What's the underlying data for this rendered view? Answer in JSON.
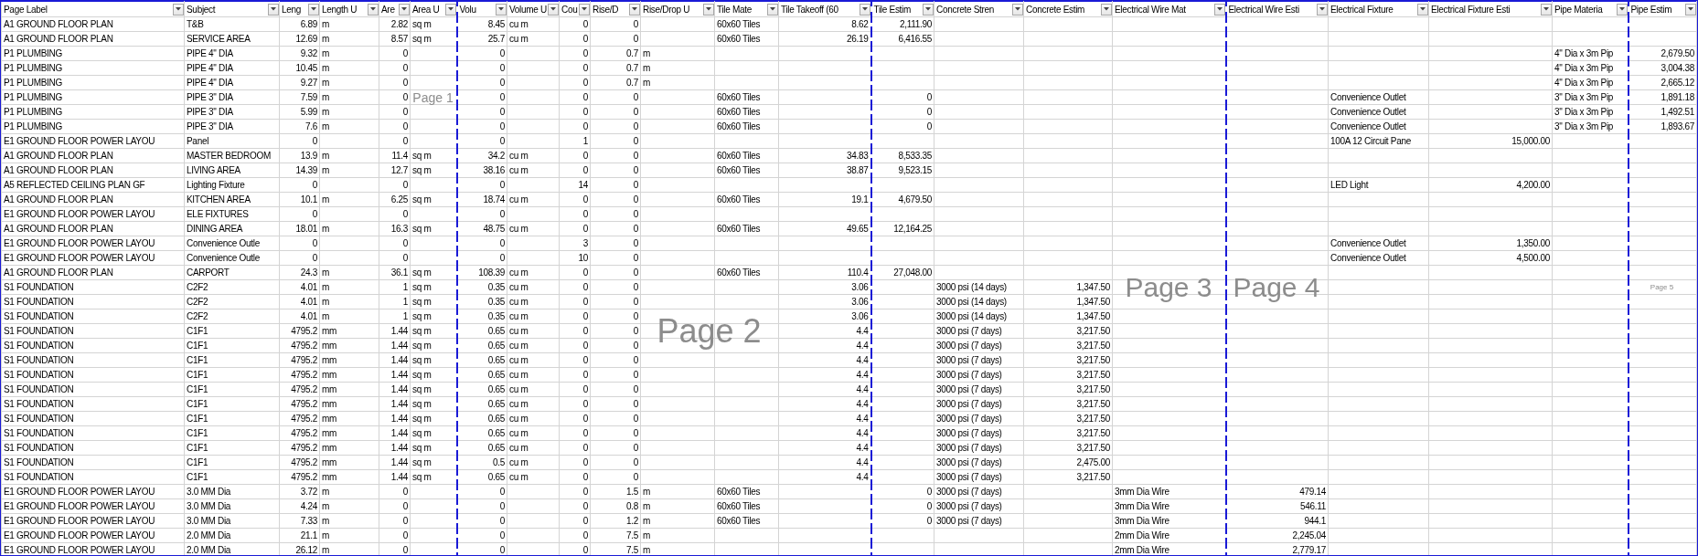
{
  "columns": [
    {
      "label": "Page Label",
      "kind": "text",
      "page_break_after": false
    },
    {
      "label": "Subject",
      "kind": "text",
      "page_break_after": false
    },
    {
      "label": "Leng",
      "kind": "number",
      "page_break_after": false
    },
    {
      "label": "Length U",
      "kind": "text",
      "page_break_after": false
    },
    {
      "label": "Are",
      "kind": "number",
      "page_break_after": false
    },
    {
      "label": "Area U",
      "kind": "text",
      "page_break_after": true
    },
    {
      "label": "Volu",
      "kind": "number",
      "page_break_after": false
    },
    {
      "label": "Volume U",
      "kind": "text",
      "page_break_after": false
    },
    {
      "label": "Cou",
      "kind": "number",
      "page_break_after": false
    },
    {
      "label": "Rise/D",
      "kind": "number",
      "page_break_after": false
    },
    {
      "label": "Rise/Drop U",
      "kind": "text",
      "page_break_after": false
    },
    {
      "label": "Tile Mate",
      "kind": "text",
      "page_break_after": false
    },
    {
      "label": "Tile Takeoff (60",
      "kind": "number",
      "page_break_after": true
    },
    {
      "label": "Tile Estim",
      "kind": "number",
      "page_break_after": false
    },
    {
      "label": "Concrete Stren",
      "kind": "text",
      "page_break_after": false
    },
    {
      "label": "Concrete Estim",
      "kind": "number",
      "page_break_after": false
    },
    {
      "label": "Electrical Wire Mat",
      "kind": "text",
      "page_break_after": true
    },
    {
      "label": "Electrical Wire Esti",
      "kind": "number",
      "page_break_after": false
    },
    {
      "label": "Electrical Fixture",
      "kind": "text",
      "page_break_after": false
    },
    {
      "label": "Electrical Fixture Esti",
      "kind": "number",
      "page_break_after": false
    },
    {
      "label": "Pipe Materia",
      "kind": "text",
      "page_break_after": true
    },
    {
      "label": "Pipe Estim",
      "kind": "number",
      "page_break_after": false
    }
  ],
  "pages": [
    {
      "label": "Page 1"
    },
    {
      "label": "Page 2"
    },
    {
      "label": "Page 3"
    },
    {
      "label": "Page 4"
    },
    {
      "label": "Page 5"
    }
  ],
  "rows": [
    [
      "A1 GROUND FLOOR PLAN",
      "T&B",
      "6.89",
      "m",
      "2.82",
      "sq m",
      "8.45",
      "cu m",
      "0",
      "0",
      null,
      "60x60 Tiles",
      "8.62",
      "2,111.90",
      null,
      null,
      null,
      null,
      null,
      null,
      null,
      null
    ],
    [
      "A1 GROUND FLOOR PLAN",
      "SERVICE AREA",
      "12.69",
      "m",
      "8.57",
      "sq m",
      "25.7",
      "cu m",
      "0",
      "0",
      null,
      "60x60 Tiles",
      "26.19",
      "6,416.55",
      null,
      null,
      null,
      null,
      null,
      null,
      null,
      null
    ],
    [
      "P1 PLUMBING",
      "PIPE 4\" DIA",
      "9.32",
      "m",
      "0",
      null,
      "0",
      null,
      "0",
      "0.7",
      "m",
      null,
      null,
      null,
      null,
      null,
      null,
      null,
      null,
      null,
      "4\" Dia x 3m Pip",
      "2,679.50"
    ],
    [
      "P1 PLUMBING",
      "PIPE 4\" DIA",
      "10.45",
      "m",
      "0",
      null,
      "0",
      null,
      "0",
      "0.7",
      "m",
      null,
      null,
      null,
      null,
      null,
      null,
      null,
      null,
      null,
      "4\" Dia x 3m Pip",
      "3,004.38"
    ],
    [
      "P1 PLUMBING",
      "PIPE 4\" DIA",
      "9.27",
      "m",
      "0",
      null,
      "0",
      null,
      "0",
      "0.7",
      "m",
      null,
      null,
      null,
      null,
      null,
      null,
      null,
      null,
      null,
      "4\" Dia x 3m Pip",
      "2,665.12"
    ],
    [
      "P1 PLUMBING",
      "PIPE 3\" DIA",
      "7.59",
      "m",
      "0",
      null,
      "0",
      null,
      "0",
      "0",
      null,
      "60x60 Tiles",
      null,
      "0",
      null,
      null,
      null,
      null,
      "Convenience Outlet",
      null,
      "3\" Dia x 3m Pip",
      "1,891.18"
    ],
    [
      "P1 PLUMBING",
      "PIPE 3\" DIA",
      "5.99",
      "m",
      "0",
      null,
      "0",
      null,
      "0",
      "0",
      null,
      "60x60 Tiles",
      null,
      "0",
      null,
      null,
      null,
      null,
      "Convenience Outlet",
      null,
      "3\" Dia x 3m Pip",
      "1,492.51"
    ],
    [
      "P1 PLUMBING",
      "PIPE 3\" DIA",
      "7.6",
      "m",
      "0",
      null,
      "0",
      null,
      "0",
      "0",
      null,
      "60x60 Tiles",
      null,
      "0",
      null,
      null,
      null,
      null,
      "Convenience Outlet",
      null,
      "3\" Dia x 3m Pip",
      "1,893.67"
    ],
    [
      "E1 GROUND FLOOR POWER LAYOU",
      "Panel",
      "0",
      null,
      "0",
      null,
      "0",
      null,
      "1",
      "0",
      null,
      null,
      null,
      null,
      null,
      null,
      null,
      null,
      "100A 12 Circuit Pane",
      "15,000.00",
      null,
      null
    ],
    [
      "A1 GROUND FLOOR PLAN",
      "MASTER BEDROOM",
      "13.9",
      "m",
      "11.4",
      "sq m",
      "34.2",
      "cu m",
      "0",
      "0",
      null,
      "60x60 Tiles",
      "34.83",
      "8,533.35",
      null,
      null,
      null,
      null,
      null,
      null,
      null,
      null
    ],
    [
      "A1 GROUND FLOOR PLAN",
      "LIVING AREA",
      "14.39",
      "m",
      "12.7",
      "sq m",
      "38.16",
      "cu m",
      "0",
      "0",
      null,
      "60x60 Tiles",
      "38.87",
      "9,523.15",
      null,
      null,
      null,
      null,
      null,
      null,
      null,
      null
    ],
    [
      "A5 REFLECTED CEILING PLAN GF",
      "Lighting Fixture",
      "0",
      null,
      "0",
      null,
      "0",
      null,
      "14",
      "0",
      null,
      null,
      null,
      null,
      null,
      null,
      null,
      null,
      "LED Light",
      "4,200.00",
      null,
      null
    ],
    [
      "A1 GROUND FLOOR PLAN",
      "KITCHEN AREA",
      "10.1",
      "m",
      "6.25",
      "sq m",
      "18.74",
      "cu m",
      "0",
      "0",
      null,
      "60x60 Tiles",
      "19.1",
      "4,679.50",
      null,
      null,
      null,
      null,
      null,
      null,
      null,
      null
    ],
    [
      "E1 GROUND FLOOR POWER LAYOU",
      "ELE FIXTURES",
      "0",
      null,
      "0",
      null,
      "0",
      null,
      "0",
      "0",
      null,
      null,
      null,
      null,
      null,
      null,
      null,
      null,
      null,
      null,
      null,
      null
    ],
    [
      "A1 GROUND FLOOR PLAN",
      "DINING AREA",
      "18.01",
      "m",
      "16.3",
      "sq m",
      "48.75",
      "cu m",
      "0",
      "0",
      null,
      "60x60 Tiles",
      "49.65",
      "12,164.25",
      null,
      null,
      null,
      null,
      null,
      null,
      null,
      null
    ],
    [
      "E1 GROUND FLOOR POWER LAYOU",
      "Convenience Outle",
      "0",
      null,
      "0",
      null,
      "0",
      null,
      "3",
      "0",
      null,
      null,
      null,
      null,
      null,
      null,
      null,
      null,
      "Convenience Outlet",
      "1,350.00",
      null,
      null
    ],
    [
      "E1 GROUND FLOOR POWER LAYOU",
      "Convenience Outle",
      "0",
      null,
      "0",
      null,
      "0",
      null,
      "10",
      "0",
      null,
      null,
      null,
      null,
      null,
      null,
      null,
      null,
      "Convenience Outlet",
      "4,500.00",
      null,
      null
    ],
    [
      "A1 GROUND FLOOR PLAN",
      "CARPORT",
      "24.3",
      "m",
      "36.1",
      "sq m",
      "108.39",
      "cu m",
      "0",
      "0",
      null,
      "60x60 Tiles",
      "110.4",
      "27,048.00",
      null,
      null,
      null,
      null,
      null,
      null,
      null,
      null
    ],
    [
      "S1 FOUNDATION",
      "C2F2",
      "4.01",
      "m",
      "1",
      "sq m",
      "0.35",
      "cu m",
      "0",
      "0",
      null,
      null,
      "3.06",
      null,
      "3000 psi (14 days)",
      "1,347.50",
      null,
      null,
      null,
      null,
      null,
      null
    ],
    [
      "S1 FOUNDATION",
      "C2F2",
      "4.01",
      "m",
      "1",
      "sq m",
      "0.35",
      "cu m",
      "0",
      "0",
      null,
      null,
      "3.06",
      null,
      "3000 psi (14 days)",
      "1,347.50",
      null,
      null,
      null,
      null,
      null,
      null
    ],
    [
      "S1 FOUNDATION",
      "C2F2",
      "4.01",
      "m",
      "1",
      "sq m",
      "0.35",
      "cu m",
      "0",
      "0",
      null,
      null,
      "3.06",
      null,
      "3000 psi (14 days)",
      "1,347.50",
      null,
      null,
      null,
      null,
      null,
      null
    ],
    [
      "S1 FOUNDATION",
      "C1F1",
      "4795.2",
      "mm",
      "1.44",
      "sq m",
      "0.65",
      "cu m",
      "0",
      "0",
      null,
      null,
      "4.4",
      null,
      "3000 psi (7 days)",
      "3,217.50",
      null,
      null,
      null,
      null,
      null,
      null
    ],
    [
      "S1 FOUNDATION",
      "C1F1",
      "4795.2",
      "mm",
      "1.44",
      "sq m",
      "0.65",
      "cu m",
      "0",
      "0",
      null,
      null,
      "4.4",
      null,
      "3000 psi (7 days)",
      "3,217.50",
      null,
      null,
      null,
      null,
      null,
      null
    ],
    [
      "S1 FOUNDATION",
      "C1F1",
      "4795.2",
      "mm",
      "1.44",
      "sq m",
      "0.65",
      "cu m",
      "0",
      "0",
      null,
      null,
      "4.4",
      null,
      "3000 psi (7 days)",
      "3,217.50",
      null,
      null,
      null,
      null,
      null,
      null
    ],
    [
      "S1 FOUNDATION",
      "C1F1",
      "4795.2",
      "mm",
      "1.44",
      "sq m",
      "0.65",
      "cu m",
      "0",
      "0",
      null,
      null,
      "4.4",
      null,
      "3000 psi (7 days)",
      "3,217.50",
      null,
      null,
      null,
      null,
      null,
      null
    ],
    [
      "S1 FOUNDATION",
      "C1F1",
      "4795.2",
      "mm",
      "1.44",
      "sq m",
      "0.65",
      "cu m",
      "0",
      "0",
      null,
      null,
      "4.4",
      null,
      "3000 psi (7 days)",
      "3,217.50",
      null,
      null,
      null,
      null,
      null,
      null
    ],
    [
      "S1 FOUNDATION",
      "C1F1",
      "4795.2",
      "mm",
      "1.44",
      "sq m",
      "0.65",
      "cu m",
      "0",
      "0",
      null,
      null,
      "4.4",
      null,
      "3000 psi (7 days)",
      "3,217.50",
      null,
      null,
      null,
      null,
      null,
      null
    ],
    [
      "S1 FOUNDATION",
      "C1F1",
      "4795.2",
      "mm",
      "1.44",
      "sq m",
      "0.65",
      "cu m",
      "0",
      "0",
      null,
      null,
      "4.4",
      null,
      "3000 psi (7 days)",
      "3,217.50",
      null,
      null,
      null,
      null,
      null,
      null
    ],
    [
      "S1 FOUNDATION",
      "C1F1",
      "4795.2",
      "mm",
      "1.44",
      "sq m",
      "0.65",
      "cu m",
      "0",
      "0",
      null,
      null,
      "4.4",
      null,
      "3000 psi (7 days)",
      "3,217.50",
      null,
      null,
      null,
      null,
      null,
      null
    ],
    [
      "S1 FOUNDATION",
      "C1F1",
      "4795.2",
      "mm",
      "1.44",
      "sq m",
      "0.65",
      "cu m",
      "0",
      "0",
      null,
      null,
      "4.4",
      null,
      "3000 psi (7 days)",
      "3,217.50",
      null,
      null,
      null,
      null,
      null,
      null
    ],
    [
      "S1 FOUNDATION",
      "C1F1",
      "4795.2",
      "mm",
      "1.44",
      "sq m",
      "0.5",
      "cu m",
      "0",
      "0",
      null,
      null,
      "4.4",
      null,
      "3000 psi (7 days)",
      "2,475.00",
      null,
      null,
      null,
      null,
      null,
      null
    ],
    [
      "S1 FOUNDATION",
      "C1F1",
      "4795.2",
      "mm",
      "1.44",
      "sq m",
      "0.65",
      "cu m",
      "0",
      "0",
      null,
      null,
      "4.4",
      null,
      "3000 psi (7 days)",
      "3,217.50",
      null,
      null,
      null,
      null,
      null,
      null
    ],
    [
      "E1 GROUND FLOOR POWER LAYOU",
      "3.0 MM Dia",
      "3.72",
      "m",
      "0",
      null,
      "0",
      null,
      "0",
      "1.5",
      "m",
      "60x60 Tiles",
      null,
      "0",
      "3000 psi (7 days)",
      null,
      "3mm Dia Wire",
      "479.14",
      null,
      null,
      null,
      null
    ],
    [
      "E1 GROUND FLOOR POWER LAYOU",
      "3.0 MM Dia",
      "4.24",
      "m",
      "0",
      null,
      "0",
      null,
      "0",
      "0.8",
      "m",
      "60x60 Tiles",
      null,
      "0",
      "3000 psi (7 days)",
      null,
      "3mm Dia Wire",
      "546.11",
      null,
      null,
      null,
      null
    ],
    [
      "E1 GROUND FLOOR POWER LAYOU",
      "3.0 MM Dia",
      "7.33",
      "m",
      "0",
      null,
      "0",
      null,
      "0",
      "1.2",
      "m",
      "60x60 Tiles",
      null,
      "0",
      "3000 psi (7 days)",
      null,
      "3mm Dia Wire",
      "944.1",
      null,
      null,
      null,
      null
    ],
    [
      "E1 GROUND FLOOR POWER LAYOU",
      "2.0 MM Dia",
      "21.1",
      "m",
      "0",
      null,
      "0",
      null,
      "0",
      "7.5",
      "m",
      null,
      null,
      null,
      null,
      null,
      "2mm Dia Wire",
      "2,245.04",
      null,
      null,
      null,
      null
    ],
    [
      "E1 GROUND FLOOR POWER LAYOU",
      "2.0 MM Dia",
      "26.12",
      "m",
      "0",
      null,
      "0",
      null,
      "0",
      "7.5",
      "m",
      null,
      null,
      null,
      null,
      null,
      "2mm Dia Wire",
      "2,779.17",
      null,
      null,
      null,
      null
    ]
  ]
}
